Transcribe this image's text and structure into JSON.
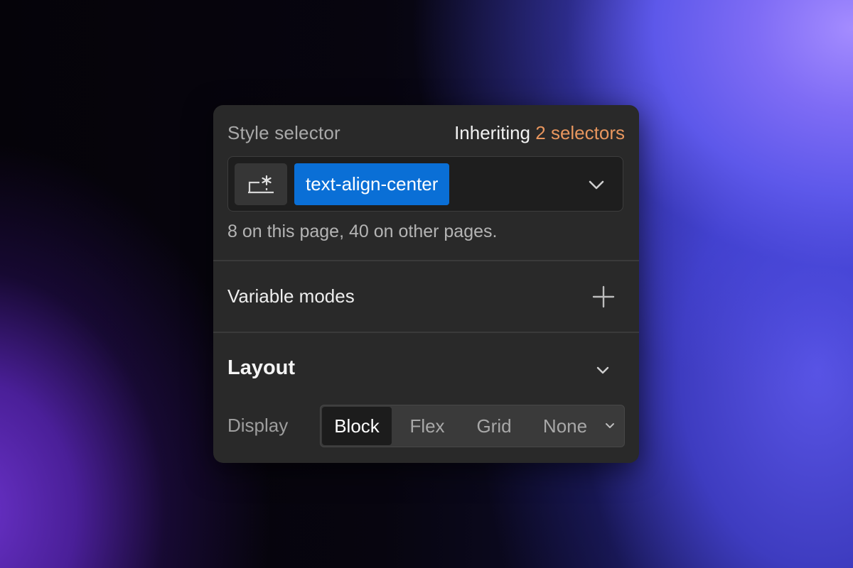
{
  "style_selector": {
    "label": "Style selector",
    "inherit_prefix": "Inheriting",
    "inherit_count": "2 selectors",
    "token": "text-align-center",
    "icon": "selector-settings-icon",
    "usage": "8 on this page, 40 on other pages."
  },
  "variable_modes": {
    "label": "Variable modes",
    "add_icon": "plus-icon"
  },
  "layout": {
    "title": "Layout",
    "display_label": "Display",
    "options": [
      "Block",
      "Flex",
      "Grid",
      "None"
    ],
    "selected": "Block"
  },
  "colors": {
    "panel_bg": "#292929",
    "token_bg": "#0a6fd6",
    "accent_orange": "#e8965e"
  }
}
